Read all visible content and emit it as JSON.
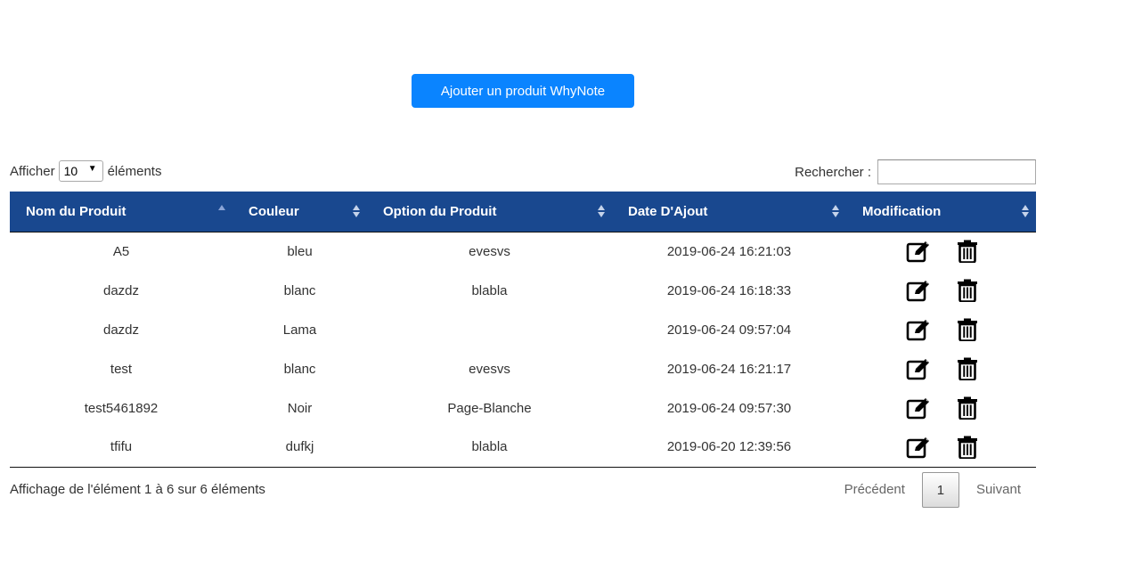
{
  "add_button": {
    "label": "Ajouter un produit WhyNote"
  },
  "length_control": {
    "prefix": "Afficher",
    "value": "10",
    "suffix": "éléments"
  },
  "search": {
    "label": "Rechercher :",
    "value": ""
  },
  "table": {
    "columns": [
      {
        "label": "Nom du Produit",
        "sort": "asc"
      },
      {
        "label": "Couleur",
        "sort": "both"
      },
      {
        "label": "Option du Produit",
        "sort": "both"
      },
      {
        "label": "Date D'Ajout",
        "sort": "both"
      },
      {
        "label": "Modification",
        "sort": "both"
      }
    ],
    "rows": [
      {
        "name": "A5",
        "color": "bleu",
        "option": "evesvs",
        "date": "2019-06-24 16:21:03"
      },
      {
        "name": "dazdz",
        "color": "blanc",
        "option": "blabla",
        "date": "2019-06-24 16:18:33"
      },
      {
        "name": "dazdz",
        "color": "Lama",
        "option": "",
        "date": "2019-06-24 09:57:04"
      },
      {
        "name": "test",
        "color": "blanc",
        "option": "evesvs",
        "date": "2019-06-24 16:21:17"
      },
      {
        "name": "test5461892",
        "color": "Noir",
        "option": "Page-Blanche",
        "date": "2019-06-24 09:57:30"
      },
      {
        "name": "tfifu",
        "color": "dufkj",
        "option": "blabla",
        "date": "2019-06-20 12:39:56"
      }
    ],
    "row_actions": [
      "edit-icon",
      "trash-icon"
    ]
  },
  "info": {
    "text": "Affichage de l'élément 1 à 6 sur 6 éléments"
  },
  "pagination": {
    "previous": "Précédent",
    "current": "1",
    "next": "Suivant"
  },
  "colors": {
    "header_bg": "#19488f",
    "button_bg": "#0a84ff",
    "header_text": "#ffffff"
  }
}
